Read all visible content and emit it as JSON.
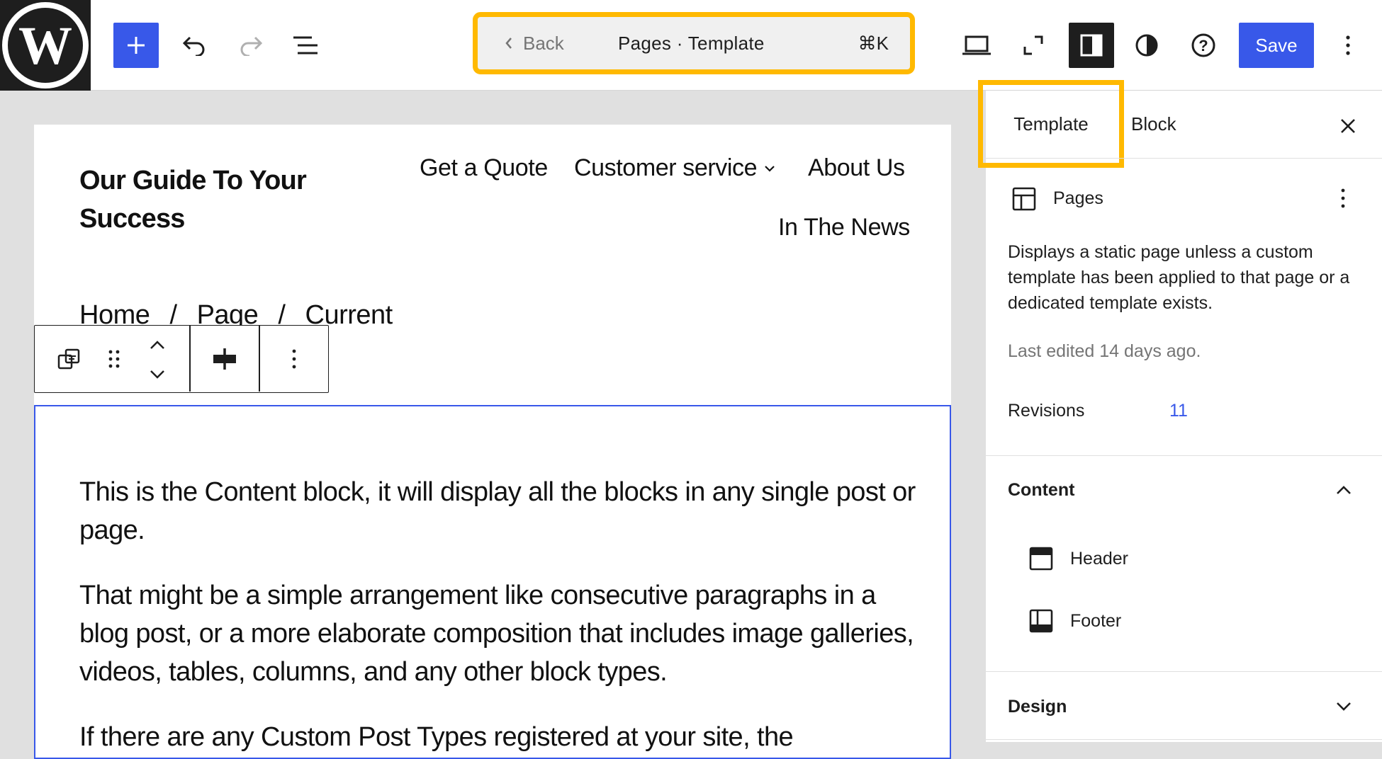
{
  "header": {
    "command_bar": {
      "back_label": "Back",
      "title": "Pages · Template",
      "shortcut": "⌘K"
    },
    "save_label": "Save",
    "icons": [
      "wordpress-logo-icon",
      "plus-icon",
      "undo-icon",
      "redo-icon",
      "list-view-icon",
      "laptop-icon",
      "fullscreen-icon",
      "sidebar-icon",
      "contrast-icon",
      "help-icon",
      "more-vertical-icon"
    ],
    "colors": {
      "accent": "#3858e9",
      "highlight": "#ffb900",
      "dark": "#1e1e1e"
    }
  },
  "canvas": {
    "site_title": "Our Guide To Your Success",
    "nav": {
      "items": [
        "Get a Quote",
        "Customer service",
        "About Us",
        "In The News"
      ]
    },
    "breadcrumb": {
      "items": [
        "Home",
        "Page",
        "Current"
      ],
      "separator": "/"
    },
    "content": {
      "paragraphs": [
        "This is the Content block, it will display all the blocks in any single post or page.",
        "That might be a simple arrangement like consecutive paragraphs in a blog post, or a more elaborate composition that includes image galleries, videos, tables, columns, and any other block types.",
        "If there are any Custom Post Types registered at your site, the"
      ]
    }
  },
  "sidebar": {
    "tabs": [
      {
        "label": "Template",
        "active": true
      },
      {
        "label": "Block",
        "active": false
      }
    ],
    "template_name": "Pages",
    "description": "Displays a static page unless a custom template has been applied to that page or a dedicated template exists.",
    "last_edited": "Last edited 14 days ago.",
    "revisions_label": "Revisions",
    "revisions_count": "11",
    "content_panel": {
      "title": "Content",
      "items": [
        "Header",
        "Footer"
      ]
    },
    "design_panel": {
      "title": "Design"
    }
  }
}
